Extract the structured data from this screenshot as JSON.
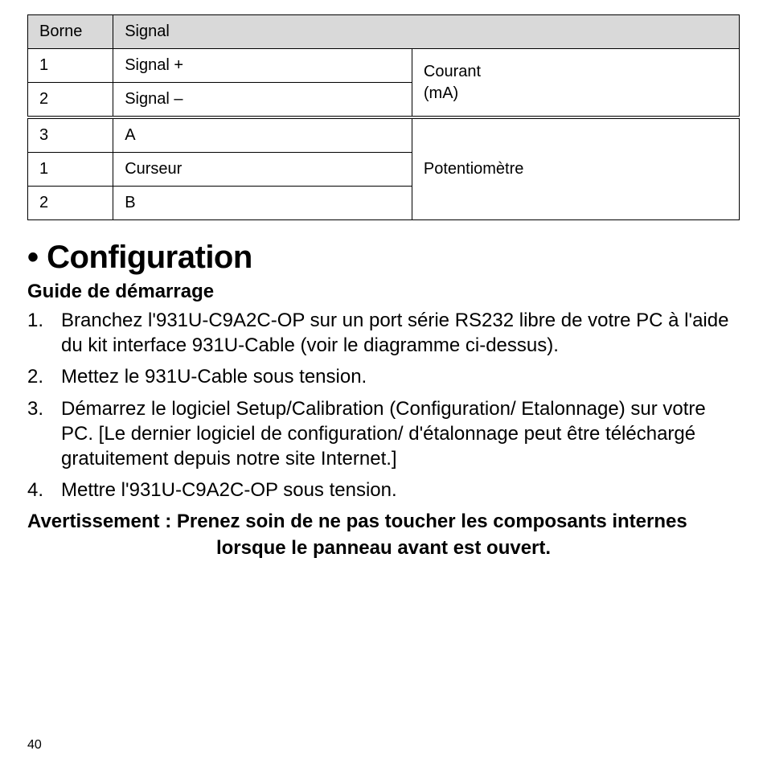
{
  "table": {
    "headers": {
      "col1": "Borne",
      "col2": "Signal"
    },
    "group1": {
      "rows": [
        {
          "borne": "1",
          "signal": "Signal +"
        },
        {
          "borne": "2",
          "signal": "Signal –"
        }
      ],
      "type_line1": "Courant",
      "type_line2": "(mA)"
    },
    "group2": {
      "rows": [
        {
          "borne": "3",
          "signal": "A"
        },
        {
          "borne": "1",
          "signal": "Curseur"
        },
        {
          "borne": "2",
          "signal": "B"
        }
      ],
      "type": "Potentiomètre"
    }
  },
  "heading": "Configuration",
  "subheading": "Guide de démarrage",
  "steps": [
    "Branchez l'931U-C9A2C-OP sur un port série RS232 libre de votre PC à l'aide du kit interface 931U-Cable (voir le diagramme ci-dessus).",
    "Mettez le 931U-Cable sous tension.",
    "Démarrez le logiciel Setup/Calibration (Configuration/ Etalonnage) sur votre PC. [Le dernier logiciel de configuration/ d'étalonnage peut être téléchargé gratuitement depuis notre site Internet.]",
    "Mettre l'931U-C9A2C-OP sous tension."
  ],
  "warning_line1": "Avertissement : Prenez soin de ne pas toucher les composants internes",
  "warning_line2": "lorsque le panneau avant est ouvert.",
  "page_number": "40"
}
